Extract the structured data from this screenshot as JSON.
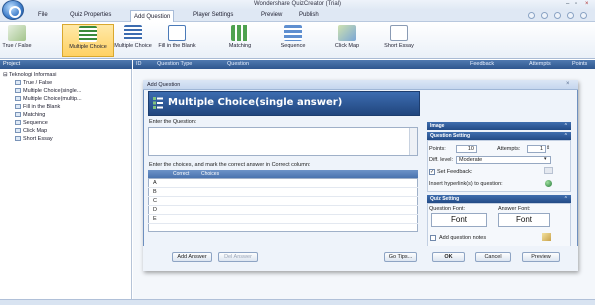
{
  "window": {
    "title": "Wondershare QuizCreator (Trial)",
    "controls": [
      "–",
      "▫",
      "×"
    ]
  },
  "menu": {
    "items": [
      "File",
      "Quiz Properties",
      "Add Question",
      "Player Settings",
      "Preview",
      "Publish"
    ],
    "active": "Add Question"
  },
  "ribbon": {
    "buttons": [
      "True / False",
      "Multiple Choice",
      "Multiple Choice",
      "Fill in the Blank",
      "Matching",
      "Sequence",
      "Click Map",
      "Short Essay"
    ],
    "selected_index": 1
  },
  "project": {
    "header": "Project",
    "root": "Teknologi Informasi",
    "items": [
      "True / False",
      "Multiple Choice(single...",
      "Multiple Choice(multip...",
      "Fill in the Blank",
      "Matching",
      "Sequence",
      "Click Map",
      "Short Essay"
    ]
  },
  "question_list": {
    "columns": [
      "ID",
      "Question Type",
      "Question",
      "Feedback",
      "Attempts",
      "Points"
    ]
  },
  "dialog": {
    "title": "Add Question",
    "question_type": "Multiple Choice(single answer)",
    "enter_question_label": "Enter the Question:",
    "choices_instruction": "Enter the choices, and mark the correct answer in Correct column:",
    "choices_columns": [
      "Correct",
      "Choices"
    ],
    "choice_letters": [
      "A",
      "B",
      "C",
      "D",
      "E"
    ],
    "buttons": {
      "add_answer": "Add Answer",
      "del_answer": "Del Answer",
      "go_tips": "Go Tips...",
      "ok": "OK",
      "cancel": "Cancel",
      "preview": "Preview"
    },
    "panels": {
      "image": "Image",
      "question_setting": {
        "title": "Question Setting",
        "points_label": "Points:",
        "points_value": "10",
        "attempts_label": "Attempts:",
        "attempts_value": "1",
        "diff_label": "Diff. level:",
        "diff_value": "Moderate",
        "set_feedback_label": "Set Feedback:",
        "set_feedback_checked": true,
        "hyperlink_label": "Insert hyperlink(s) to question:"
      },
      "quiz_setting": {
        "title": "Quiz Setting",
        "question_font_label": "Question Font:",
        "answer_font_label": "Answer Font:",
        "question_font_btn": "Font",
        "answer_font_btn": "Font",
        "add_notes_label": "Add question notes",
        "add_notes_checked": false
      }
    }
  },
  "colors": {
    "header_blue": "#2e568e",
    "ribbon_selected": "#ffd163",
    "dialog_banner": "#21467e"
  }
}
